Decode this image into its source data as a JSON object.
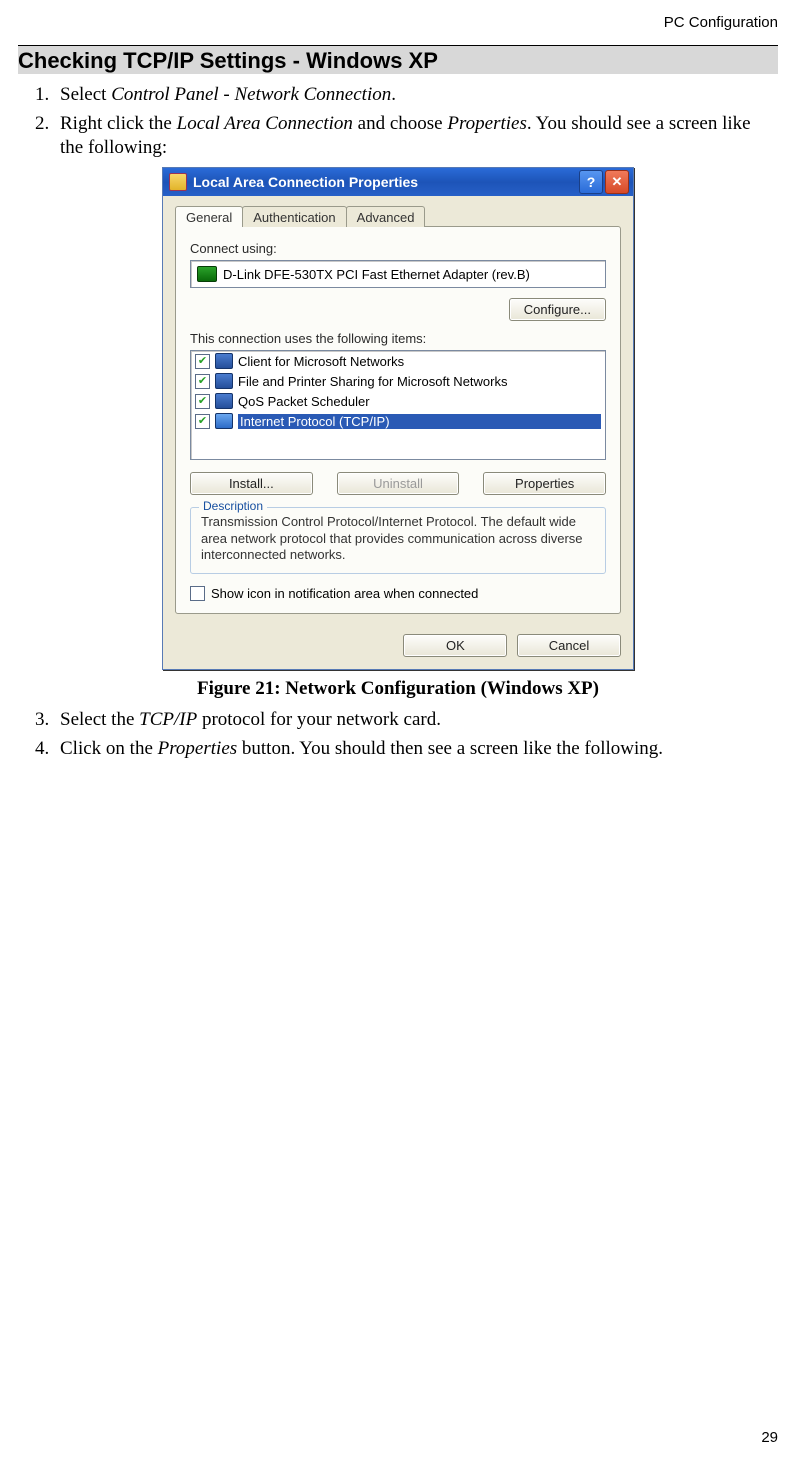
{
  "header": {
    "section": "PC Configuration"
  },
  "title": "Checking TCP/IP Settings - Windows XP",
  "steps_a": [
    {
      "num": "1.",
      "parts": [
        {
          "t": "Select "
        },
        {
          "t": "Control Panel - Network Connection",
          "i": true
        },
        {
          "t": "."
        }
      ]
    },
    {
      "num": "2.",
      "parts": [
        {
          "t": "Right click the "
        },
        {
          "t": "Local Area Connection",
          "i": true
        },
        {
          "t": " and choose "
        },
        {
          "t": "Properties",
          "i": true
        },
        {
          "t": ". You should see a screen like the following:"
        }
      ]
    }
  ],
  "dialog": {
    "title": "Local Area Connection Properties",
    "tabs": [
      "General",
      "Authentication",
      "Advanced"
    ],
    "connect_label": "Connect using:",
    "adapter": "D-Link DFE-530TX PCI Fast Ethernet Adapter (rev.B)",
    "configure": "Configure...",
    "items_label": "This connection uses the following items:",
    "items": [
      {
        "label": "Client for Microsoft Networks",
        "checked": true,
        "sel": false
      },
      {
        "label": "File and Printer Sharing for Microsoft Networks",
        "checked": true,
        "sel": false
      },
      {
        "label": "QoS Packet Scheduler",
        "checked": true,
        "sel": false
      },
      {
        "label": "Internet Protocol (TCP/IP)",
        "checked": true,
        "sel": true
      }
    ],
    "install": "Install...",
    "uninstall": "Uninstall",
    "properties": "Properties",
    "desc_legend": "Description",
    "desc_text": "Transmission Control Protocol/Internet Protocol. The default wide area network protocol that provides communication across diverse interconnected networks.",
    "show_icon": "Show icon in notification area when connected",
    "ok": "OK",
    "cancel": "Cancel"
  },
  "figure_caption": "Figure 21: Network Configuration (Windows  XP)",
  "steps_b": [
    {
      "num": "3.",
      "parts": [
        {
          "t": "Select the "
        },
        {
          "t": "TCP/IP",
          "i": true
        },
        {
          "t": " protocol for your network card."
        }
      ]
    },
    {
      "num": "4.",
      "parts": [
        {
          "t": "Click on the "
        },
        {
          "t": "Properties",
          "i": true
        },
        {
          "t": " button. You should then see a screen like the following."
        }
      ]
    }
  ],
  "page_number": "29"
}
